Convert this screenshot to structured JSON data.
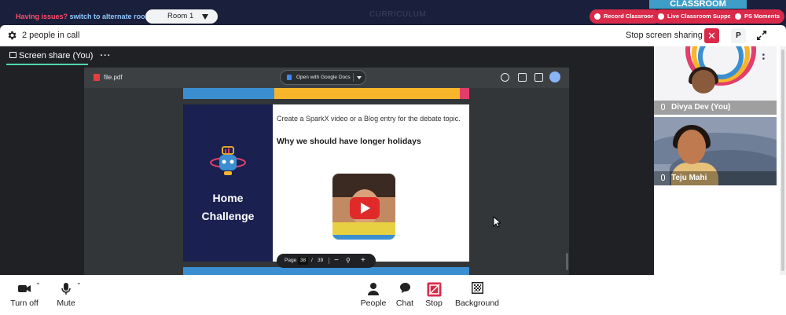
{
  "banner": {
    "issue_text": "Having issues?",
    "switch_text": "switch to alternate room",
    "curriculum_text": "CURRICULUM",
    "classroom_text": "CLASSROOM",
    "room_label": "Room 1",
    "pills": [
      "Record Classroom",
      "Live Classroom Support",
      "PS Moments"
    ]
  },
  "call_header": {
    "people_count": "2 people in call",
    "stop_sharing": "Stop screen sharing",
    "close_symbol": "✕",
    "pin_label": "P"
  },
  "stage": {
    "label": "Screen share (You)",
    "more_symbol": "···"
  },
  "pdf": {
    "filename": "file.pdf",
    "open_with": "Open with Google Docs",
    "page_label": "Page",
    "current_page": "38",
    "page_separator": "/",
    "total_pages": "39"
  },
  "slide": {
    "challenge_title_line1": "Home",
    "challenge_title_line2": "Challenge",
    "instruction": "Create a SparkX video or a Blog entry for the debate topic.",
    "topic": "Why we should have longer holidays"
  },
  "participants": [
    {
      "name": "Divya Dev (You)"
    },
    {
      "name": "Teju Mahi"
    }
  ],
  "controls": {
    "camera": "Turn off",
    "mic": "Mute",
    "people": "People",
    "chat": "Chat",
    "stop": "Stop",
    "background": "Background"
  },
  "colors": {
    "accent_red": "#d92a4a",
    "share_underline": "#4ed7ad",
    "banner_bg": "#1a1f3b"
  }
}
